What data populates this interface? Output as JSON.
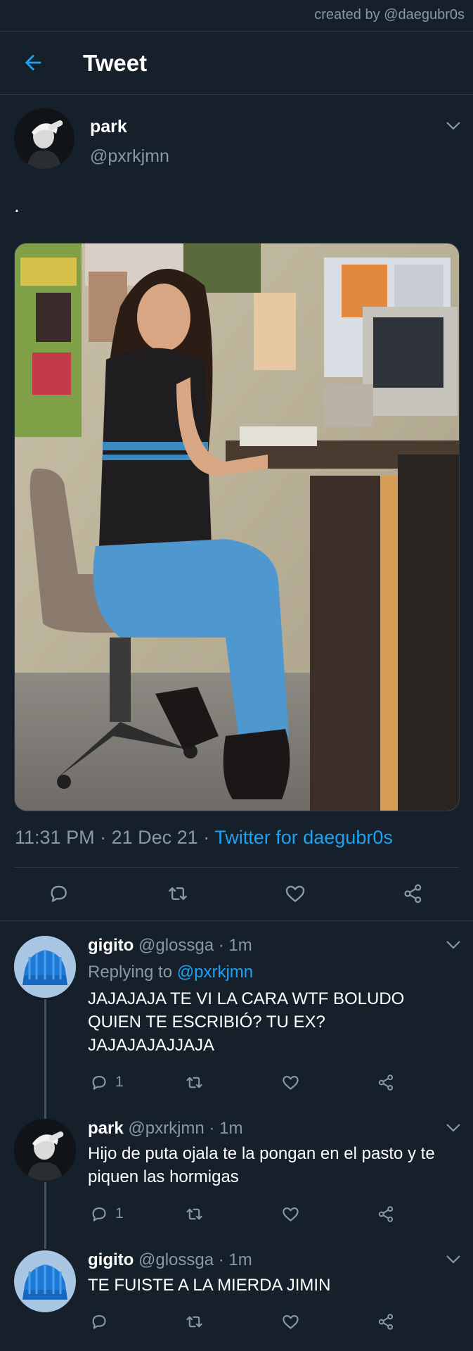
{
  "credit": "created by @daegubr0s",
  "header": {
    "title": "Tweet"
  },
  "tweet": {
    "name": "park",
    "handle": "@pxrkjmn",
    "text": ".",
    "time": "11:31 PM",
    "date": "21 Dec 21",
    "source": "Twitter for daegubr0s"
  },
  "replies": [
    {
      "name": "gigito",
      "handle": "@glossga",
      "age": "1m",
      "replying_prefix": "Replying to",
      "replying_to": "@pxrkjmn",
      "text": "JAJAJAJA TE VI LA CARA WTF BOLUDO QUIEN TE ESCRIBIÓ? TU EX? JAJAJAJAJJAJA",
      "reply_count": "1"
    },
    {
      "name": "park",
      "handle": "@pxrkjmn",
      "age": "1m",
      "text": "Hijo de puta ojala te la pongan en el pasto y te piquen las hormigas",
      "reply_count": "1"
    },
    {
      "name": "gigito",
      "handle": "@glossga",
      "age": "1m",
      "text": "TE FUISTE A LA MIERDA JIMIN",
      "reply_count": ""
    }
  ],
  "colors": {
    "background": "#15202b",
    "accent": "#1da1f2",
    "muted": "#8899a6",
    "divider": "#2f3a45"
  }
}
